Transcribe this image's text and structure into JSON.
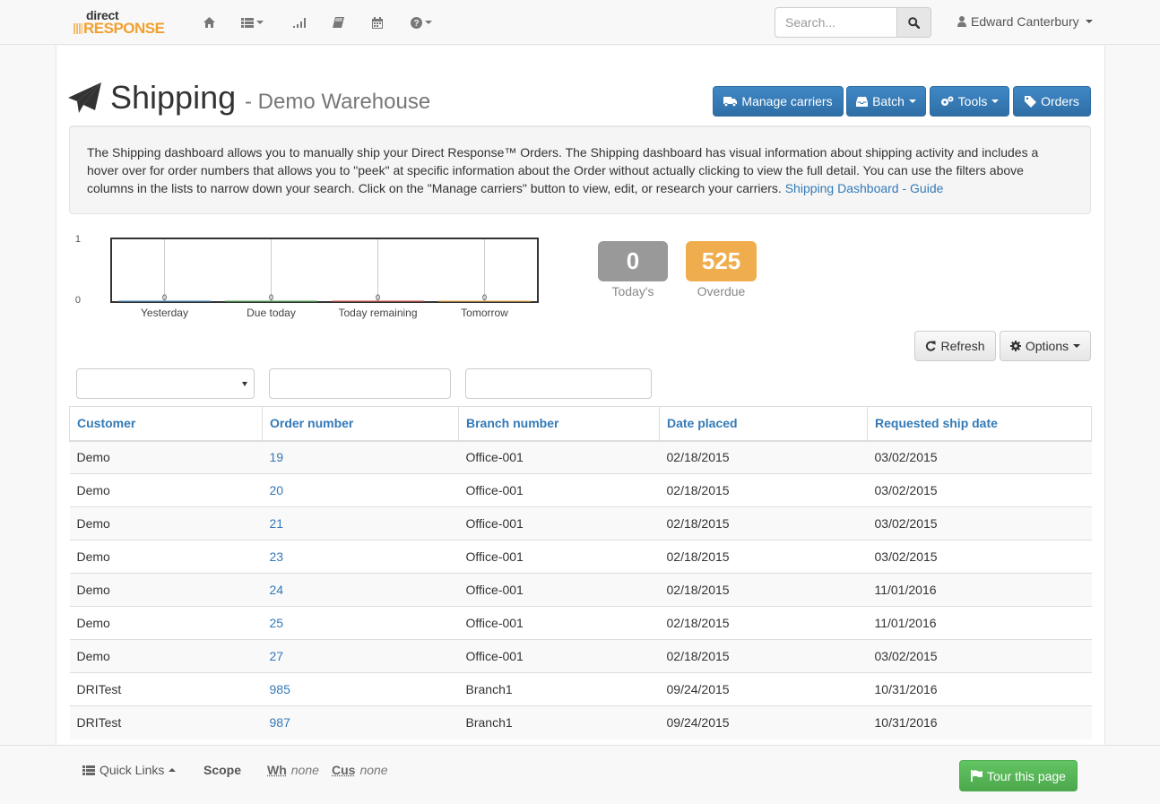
{
  "navbar": {
    "logo_top": "direct",
    "logo_bottom": "RESPONSE",
    "icons": [
      "home-icon",
      "list-icon",
      "signal-icon",
      "book-icon",
      "calendar-icon",
      "question-icon"
    ],
    "search_placeholder": "Search...",
    "user_name": "Edward Canterbury"
  },
  "page": {
    "title": "Shipping",
    "subtitle": "- Demo Warehouse",
    "actions": {
      "manage_carriers": "Manage carriers",
      "batch": "Batch",
      "tools": "Tools",
      "orders": "Orders"
    },
    "info_text": "The Shipping dashboard allows you to manually ship your Direct Response™ Orders. The Shipping dashboard has visual information about shipping activity and includes a hover over for order numbers that allows you to \"peek\" at specific information about the Order without actually clicking to view the full detail. You can use the filters above columns in the lists to narrow down your search. Click on the \"Manage carriers\" button to view, edit, or research your carriers.",
    "guide_link": "Shipping Dashboard - Guide"
  },
  "chart_data": {
    "type": "bar",
    "categories": [
      "Yesterday",
      "Due today",
      "Today remaining",
      "Tomorrow"
    ],
    "values": [
      0,
      0,
      0,
      0
    ],
    "ylim": [
      0,
      1
    ],
    "yticks": [
      "1",
      "0"
    ],
    "data_labels": [
      "0",
      "0",
      "0",
      "0"
    ],
    "colors": [
      "#4a90c8",
      "#5cb85c",
      "#d9534f",
      "#f0ad4e"
    ]
  },
  "stats": {
    "todays_value": "0",
    "todays_label": "Today's",
    "todays_color": "#999999",
    "overdue_value": "525",
    "overdue_label": "Overdue",
    "overdue_color": "#f0ad4e"
  },
  "list_controls": {
    "refresh": "Refresh",
    "options": "Options"
  },
  "table": {
    "columns": [
      "Customer",
      "Order number",
      "Branch number",
      "Date placed",
      "Requested ship date"
    ],
    "rows": [
      [
        "Demo",
        "19",
        "Office-001",
        "02/18/2015",
        "03/02/2015"
      ],
      [
        "Demo",
        "20",
        "Office-001",
        "02/18/2015",
        "03/02/2015"
      ],
      [
        "Demo",
        "21",
        "Office-001",
        "02/18/2015",
        "03/02/2015"
      ],
      [
        "Demo",
        "23",
        "Office-001",
        "02/18/2015",
        "03/02/2015"
      ],
      [
        "Demo",
        "24",
        "Office-001",
        "02/18/2015",
        "11/01/2016"
      ],
      [
        "Demo",
        "25",
        "Office-001",
        "02/18/2015",
        "11/01/2016"
      ],
      [
        "Demo",
        "27",
        "Office-001",
        "02/18/2015",
        "03/02/2015"
      ],
      [
        "DRITest",
        "985",
        "Branch1",
        "09/24/2015",
        "10/31/2016"
      ],
      [
        "DRITest",
        "987",
        "Branch1",
        "09/24/2015",
        "10/31/2016"
      ]
    ]
  },
  "footer": {
    "quick_links": "Quick Links",
    "scope": "Scope",
    "wh_abbr": "Wh",
    "wh_value": "none",
    "cus_abbr": "Cus",
    "cus_value": "none",
    "tour": "Tour this page"
  }
}
